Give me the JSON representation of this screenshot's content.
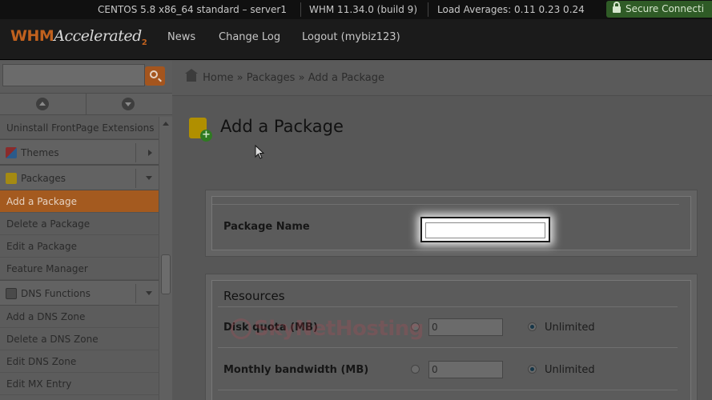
{
  "statusbar": {
    "os": "CENTOS 5.8 x86_64 standard – server1",
    "whm_version": "WHM 11.34.0 (build 9)",
    "load": "Load Averages: 0.11 0.23 0.24",
    "secure": "Secure Connecti"
  },
  "header": {
    "logo_whm": "WHM",
    "logo_accelerated": "Accelerated",
    "logo_sup": "2",
    "nav": {
      "news": "News",
      "changelog": "Change Log",
      "logout": "Logout (mybiz123)"
    }
  },
  "sidebar": {
    "search_placeholder": "",
    "items": {
      "uninstall_frontpage": "Uninstall FrontPage Extensions",
      "themes": "Themes",
      "packages": "Packages",
      "add_package": "Add a Package",
      "delete_package": "Delete a Package",
      "edit_package": "Edit a Package",
      "feature_manager": "Feature Manager",
      "dns_functions": "DNS Functions",
      "add_dns_zone": "Add a DNS Zone",
      "delete_dns_zone": "Delete a DNS Zone",
      "edit_dns_zone": "Edit DNS Zone",
      "edit_mx_entry": "Edit MX Entry"
    }
  },
  "breadcrumb": {
    "home": "Home",
    "sep": "»",
    "packages": "Packages",
    "current": "Add a Package"
  },
  "main": {
    "title": "Add a Package",
    "package_name_label": "Package Name",
    "package_name_value": "",
    "resources_title": "Resources",
    "disk_quota_label": "Disk quota (MB)",
    "disk_quota_value": "0",
    "disk_unlimited": "Unlimited",
    "bandwidth_label": "Monthly bandwidth (MB)",
    "bandwidth_value": "0",
    "bandwidth_unlimited": "Unlimited"
  },
  "watermark": "SkyNetHosting",
  "colors": {
    "accent": "#a45a1f",
    "secure_green": "#2f5b26"
  }
}
